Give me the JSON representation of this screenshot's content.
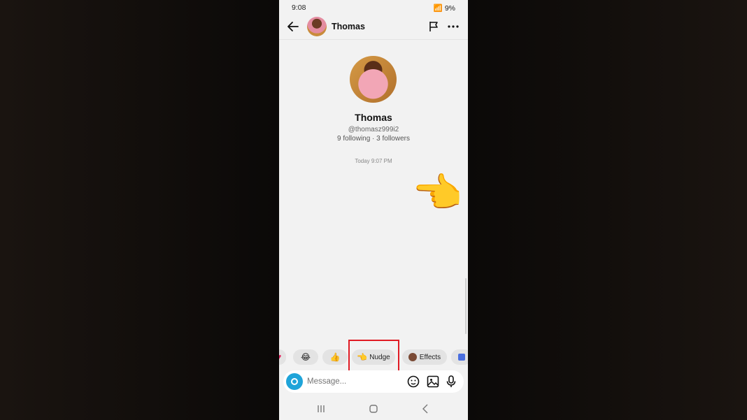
{
  "status_bar": {
    "time": "9:08",
    "battery": "9%"
  },
  "header": {
    "back": "back-arrow",
    "name": "Thomas"
  },
  "profile": {
    "name": "Thomas",
    "handle": "@thomasz999i2",
    "follow_info": "9 following · 3 followers",
    "timestamp": "Today 9:07 PM"
  },
  "message": {
    "emoji": "👈"
  },
  "quick_replies": {
    "laugh": "😂",
    "thumbs": "👍",
    "nudge_emoji": "👈",
    "nudge_label": "Nudge",
    "effects_label": "Effects"
  },
  "composer": {
    "placeholder": "Message..."
  },
  "colors": {
    "accent": "#1fa4d9",
    "highlight": "#e01b24"
  }
}
